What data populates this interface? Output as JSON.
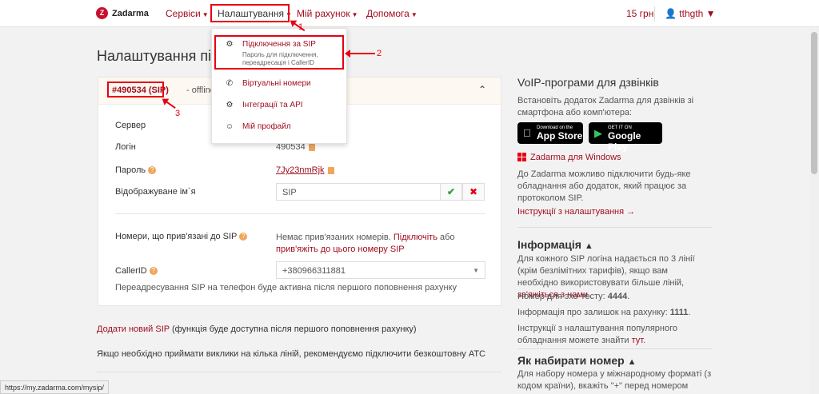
{
  "header": {
    "logo_text": "Zadarma",
    "nav": [
      {
        "label": "Сервіси"
      },
      {
        "label": "Налаштування"
      },
      {
        "label": "Мій рахунок"
      },
      {
        "label": "Допомога"
      }
    ],
    "balance": "15 грн",
    "username": "tthgth"
  },
  "dropdown": {
    "items": [
      {
        "title": "Підключення за SIP",
        "subtitle": "Пароль для підключення, переадресація і CallerID",
        "icon": "gear-icon"
      },
      {
        "title": "Віртуальні номери",
        "icon": "phone-icon"
      },
      {
        "title": "Інтеграції та API",
        "icon": "integration-icon"
      },
      {
        "title": "Мій профайл",
        "icon": "user-icon"
      }
    ]
  },
  "annotations": {
    "n1": "1",
    "n2": "2",
    "n3": "3"
  },
  "page": {
    "title": "Налаштування під"
  },
  "sip": {
    "id": "#490534 (SIP)",
    "status": "- offline",
    "server_label": "Сервер",
    "login_label": "Логін",
    "login_value": "490534",
    "password_label": "Пароль",
    "password_value": "7Jy23nmRjk",
    "display_name_label": "Відображуване ім`я",
    "display_name_value": "SIP",
    "linked_label": "Номери, що прив'язані до SIP",
    "linked_text_1": "Немає прив'язаних номерів.",
    "linked_link_1": "Підключіть",
    "linked_text_2": "або",
    "linked_link_2": "прив'яжіть до цього номеру SIP",
    "callerid_label": "CallerID",
    "callerid_value": "+380966311881",
    "forward_note": "Переадресування SIP на телефон буде активна після першого поповнення рахунку"
  },
  "below": {
    "add_sip_link": "Додати новий SIP",
    "add_sip_note": "(функція буде доступна після першого поповнення рахунку)",
    "multi_line_note": "Якщо необхідно приймати виклики на кілька ліній, рекомендуємо підключити безкоштовну АТС"
  },
  "sidebar": {
    "voip_title": "VoIP-програми для дзвінків",
    "voip_text": "Встановіть додаток Zadarma для дзвінків зі смартфона або комп'ютера:",
    "appstore_small": "Download on the",
    "appstore_big": "App Store",
    "gplay_small": "GET IT ON",
    "gplay_big": "Google Play",
    "windows_link": "Zadarma для Windows",
    "device_text": "До Zadarma можливо підключити будь-яке обладнання або додаток, який працює за протоколом SIP.",
    "instructions_link": "Інструкції з налаштування",
    "info_title": "Інформація",
    "info_text_1": "Для кожного SIP логіна надається по 3 лінії (крім безлімітних тарифів), якщо вам необхідно використовувати більше ліній,",
    "info_link_1": "зв'яжіться з нами",
    "echo_text": "Номер для эхо-тесту:",
    "echo_value": "4444",
    "balance_text": "Інформація про залишок на рахунку:",
    "balance_value": "1111",
    "setup_text": "Інструкції з налаштування популярного обладнання можете знайти",
    "setup_link": "тут",
    "dial_title": "Як набирати номер",
    "dial_text": "Для набору номера у міжнародному форматі (з кодом країни), вкажіть \"+\" перед номером"
  },
  "statusbar": {
    "url": "https://my.zadarma.com/mysip/"
  }
}
